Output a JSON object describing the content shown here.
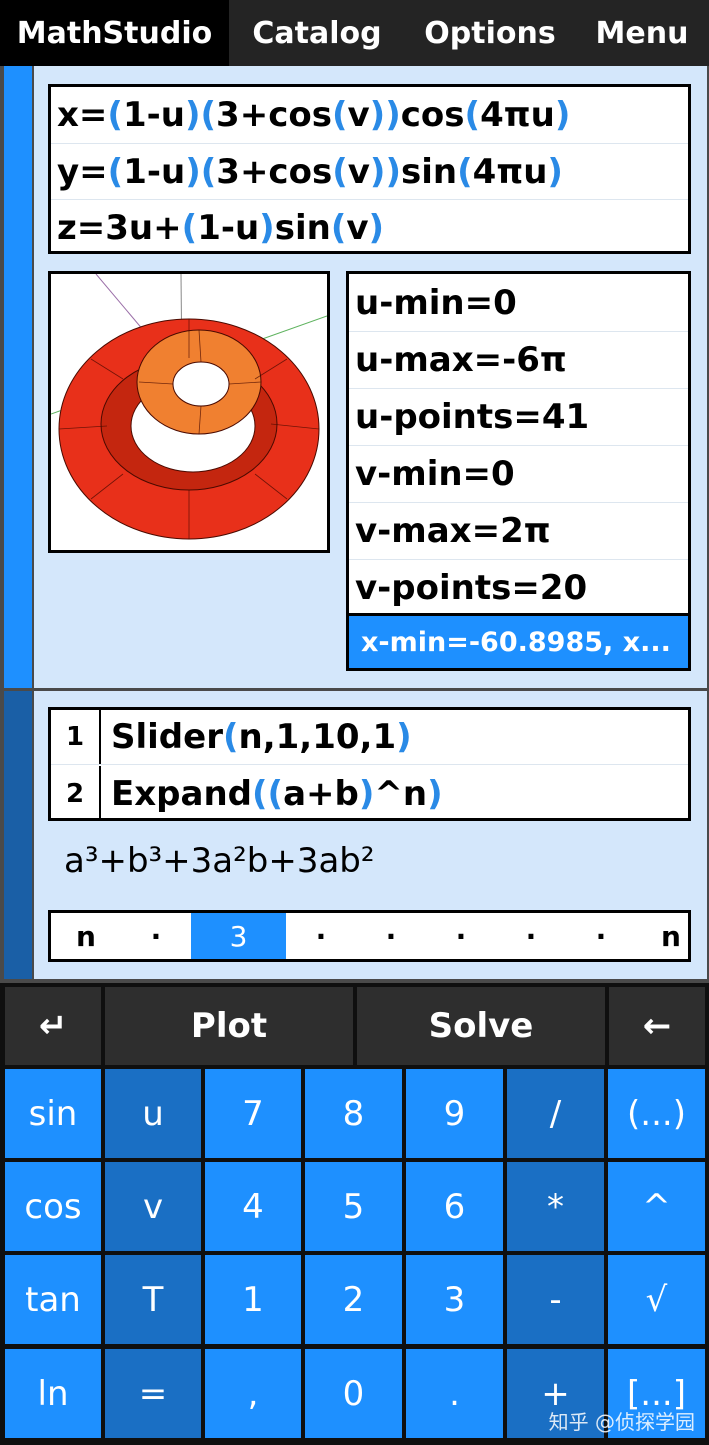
{
  "topbar": {
    "tabs": [
      "MathStudio",
      "Catalog",
      "Options",
      "Menu"
    ]
  },
  "equations": [
    [
      [
        "x=",
        "k"
      ],
      [
        "(",
        "b"
      ],
      [
        "1-u",
        "k"
      ],
      [
        ")",
        "b"
      ],
      [
        "(",
        "b"
      ],
      [
        "3+cos",
        "k"
      ],
      [
        "(",
        "b"
      ],
      [
        "v",
        "k"
      ],
      [
        ")",
        "b"
      ],
      [
        ")",
        "b"
      ],
      [
        "cos",
        "k"
      ],
      [
        "(",
        "b"
      ],
      [
        "4πu",
        "k"
      ],
      [
        ")",
        "b"
      ]
    ],
    [
      [
        "y=",
        "k"
      ],
      [
        "(",
        "b"
      ],
      [
        "1-u",
        "k"
      ],
      [
        ")",
        "b"
      ],
      [
        "(",
        "b"
      ],
      [
        "3+cos",
        "k"
      ],
      [
        "(",
        "b"
      ],
      [
        "v",
        "k"
      ],
      [
        ")",
        "b"
      ],
      [
        ")",
        "b"
      ],
      [
        "sin",
        "k"
      ],
      [
        "(",
        "b"
      ],
      [
        "4πu",
        "k"
      ],
      [
        ")",
        "b"
      ]
    ],
    [
      [
        "z=3u+",
        "k"
      ],
      [
        "(",
        "b"
      ],
      [
        "1-u",
        "k"
      ],
      [
        ")",
        "b"
      ],
      [
        "sin",
        "k"
      ],
      [
        "(",
        "b"
      ],
      [
        "v",
        "k"
      ],
      [
        ")",
        "b"
      ]
    ]
  ],
  "parameters": [
    "u-min=0",
    "u-max=-6π",
    "u-points=41",
    "v-min=0",
    "v-max=2π",
    "v-points=20"
  ],
  "view_summary": "x-min=-60.8985, x...",
  "commands": [
    {
      "num": "1",
      "tokens": [
        [
          "Slider",
          "k"
        ],
        [
          "(",
          "b"
        ],
        [
          "n,1,10,1",
          "k"
        ],
        [
          ")",
          "b"
        ]
      ]
    },
    {
      "num": "2",
      "tokens": [
        [
          "Expand",
          "k"
        ],
        [
          "(",
          "b"
        ],
        [
          "(",
          "b"
        ],
        [
          "a+b",
          "k"
        ],
        [
          ")",
          "b"
        ],
        [
          "^n",
          "k"
        ],
        [
          ")",
          "b"
        ]
      ]
    }
  ],
  "result": {
    "text": "a³+b³+3a²b+3ab²"
  },
  "slider": {
    "left_label": "n",
    "value": "3",
    "right_label": "n",
    "dot": "·"
  },
  "keyboard": {
    "top_row": [
      "↵",
      "Plot",
      "Solve",
      "←"
    ],
    "rows": [
      [
        "sin",
        "u",
        "7",
        "8",
        "9",
        "/",
        "(...)"
      ],
      [
        "cos",
        "v",
        "4",
        "5",
        "6",
        "*",
        "^"
      ],
      [
        "tan",
        "T",
        "1",
        "2",
        "3",
        "-",
        "√"
      ],
      [
        "ln",
        "=",
        ",",
        "0",
        ".",
        "+",
        "[...]"
      ]
    ]
  },
  "watermark": "知乎 @侦探学园",
  "colors": {
    "accent": "#1e90ff",
    "accent_dark": "#1a6fc4",
    "panel": "#d4e7fb",
    "surface_red": "#e8301a",
    "surface_orange": "#f08030"
  }
}
